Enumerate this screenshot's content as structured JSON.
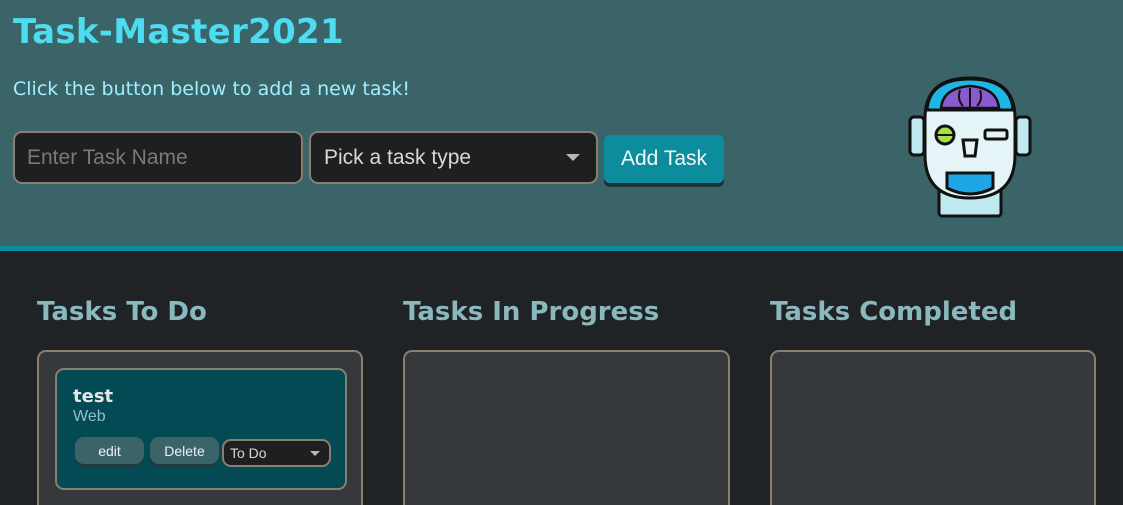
{
  "header": {
    "title": "Task-Master2021",
    "subtitle": "Click the button below to add a new task!",
    "task_input_placeholder": "Enter Task Name",
    "task_type_select": "Pick a task type",
    "add_button": "Add Task",
    "mascot_icon": "robot-icon"
  },
  "columns": [
    {
      "title": "Tasks To Do"
    },
    {
      "title": "Tasks In Progress"
    },
    {
      "title": "Tasks Completed"
    }
  ],
  "tasks": [
    {
      "name": "test",
      "type": "Web",
      "edit_label": "edit",
      "delete_label": "Delete",
      "status": "To Do"
    }
  ],
  "colors": {
    "header_bg": "#3b6468",
    "accent": "#0b8d9e",
    "title": "#4ddcf0",
    "page_bg": "#202325",
    "card_bg": "#034a54"
  }
}
